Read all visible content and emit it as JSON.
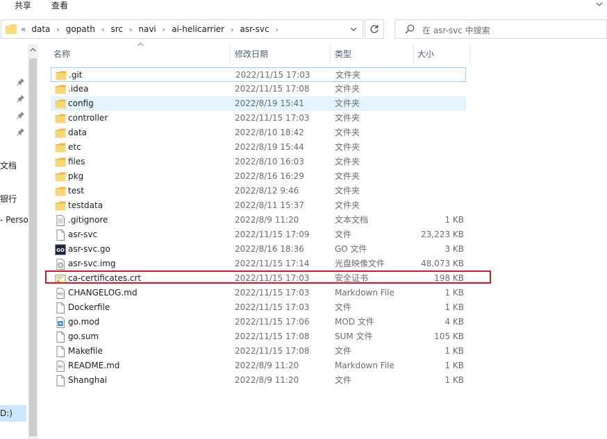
{
  "ribbon": {
    "tabs": [
      "共享",
      "查看"
    ]
  },
  "address": {
    "overflow": "«",
    "crumbs": [
      "data",
      "gopath",
      "src",
      "navi",
      "ai-helicarrier",
      "asr-svc"
    ]
  },
  "search": {
    "placeholder": "在 asr-svc 中搜索"
  },
  "nav": {
    "labels": [
      "文档",
      "银行",
      "- Perso",
      "D:)"
    ]
  },
  "columns": {
    "name": "名称",
    "date": "修改日期",
    "type": "类型",
    "size": "大小"
  },
  "files": [
    {
      "name": ".git",
      "date": "2022/11/15 17:03",
      "type": "文件夹",
      "size": "",
      "icon": "folder-icon"
    },
    {
      "name": ".idea",
      "date": "2022/11/15 17:08",
      "type": "文件夹",
      "size": "",
      "icon": "folder-icon"
    },
    {
      "name": "config",
      "date": "2022/8/19 15:41",
      "type": "文件夹",
      "size": "",
      "icon": "folder-icon"
    },
    {
      "name": "controller",
      "date": "2022/11/15 17:03",
      "type": "文件夹",
      "size": "",
      "icon": "folder-icon"
    },
    {
      "name": "data",
      "date": "2022/8/10 18:42",
      "type": "文件夹",
      "size": "",
      "icon": "folder-icon"
    },
    {
      "name": "etc",
      "date": "2022/8/19 15:44",
      "type": "文件夹",
      "size": "",
      "icon": "folder-icon"
    },
    {
      "name": "files",
      "date": "2022/8/10 16:03",
      "type": "文件夹",
      "size": "",
      "icon": "folder-icon"
    },
    {
      "name": "pkg",
      "date": "2022/8/16 16:29",
      "type": "文件夹",
      "size": "",
      "icon": "folder-icon"
    },
    {
      "name": "test",
      "date": "2022/8/12 9:46",
      "type": "文件夹",
      "size": "",
      "icon": "folder-icon"
    },
    {
      "name": "testdata",
      "date": "2022/8/11 15:37",
      "type": "文件夹",
      "size": "",
      "icon": "folder-icon"
    },
    {
      "name": ".gitignore",
      "date": "2022/8/9 11:20",
      "type": "文本文档",
      "size": "1 KB",
      "icon": "text-file-icon"
    },
    {
      "name": "asr-svc",
      "date": "2022/11/15 17:09",
      "type": "文件",
      "size": "23,223 KB",
      "icon": "file-icon"
    },
    {
      "name": "asr-svc.go",
      "date": "2022/8/16 18:36",
      "type": "GO 文件",
      "size": "3 KB",
      "icon": "go-file-icon"
    },
    {
      "name": "asr-svc.img",
      "date": "2022/11/15 17:14",
      "type": "光盘映像文件",
      "size": "48,073 KB",
      "icon": "disc-image-icon"
    },
    {
      "name": "ca-certificates.crt",
      "date": "2022/11/15 17:03",
      "type": "安全证书",
      "size": "198 KB",
      "icon": "certificate-icon"
    },
    {
      "name": "CHANGELOG.md",
      "date": "2022/11/15 17:03",
      "type": "Markdown File",
      "size": "1 KB",
      "icon": "markdown-file-icon"
    },
    {
      "name": "Dockerfile",
      "date": "2022/11/15 17:03",
      "type": "文件",
      "size": "1 KB",
      "icon": "file-icon"
    },
    {
      "name": "go.mod",
      "date": "2022/11/15 17:06",
      "type": "MOD 文件",
      "size": "4 KB",
      "icon": "mod-file-icon"
    },
    {
      "name": "go.sum",
      "date": "2022/11/15 17:08",
      "type": "SUM 文件",
      "size": "105 KB",
      "icon": "file-icon"
    },
    {
      "name": "Makefile",
      "date": "2022/11/15 17:08",
      "type": "文件",
      "size": "1 KB",
      "icon": "file-icon"
    },
    {
      "name": "README.md",
      "date": "2022/8/9 11:20",
      "type": "Markdown File",
      "size": "1 KB",
      "icon": "markdown-file-icon"
    },
    {
      "name": "Shanghai",
      "date": "2022/8/9 11:20",
      "type": "文件",
      "size": "1 KB",
      "icon": "file-icon"
    }
  ],
  "colors": {
    "selection": "#e5f3ff",
    "highlight_border": "#e0161c",
    "folder": "#f8d775"
  }
}
